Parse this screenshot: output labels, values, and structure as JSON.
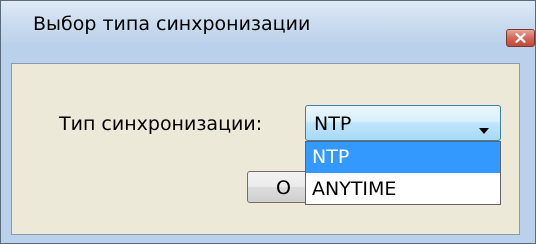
{
  "window": {
    "title": "Выбор типа синхронизации",
    "close_icon": "close-icon"
  },
  "form": {
    "label": "Тип синхронизации:",
    "combo": {
      "selected_value": "NTP",
      "arrow_icon": "chevron-down-icon",
      "options": [
        "NTP",
        "ANYTIME"
      ],
      "highlighted_index": 0
    },
    "ok_button_visible_text": "O"
  },
  "colors": {
    "selection_highlight": "#3399ff",
    "client_background": "#ece9d8",
    "close_button": "#c0493b"
  }
}
